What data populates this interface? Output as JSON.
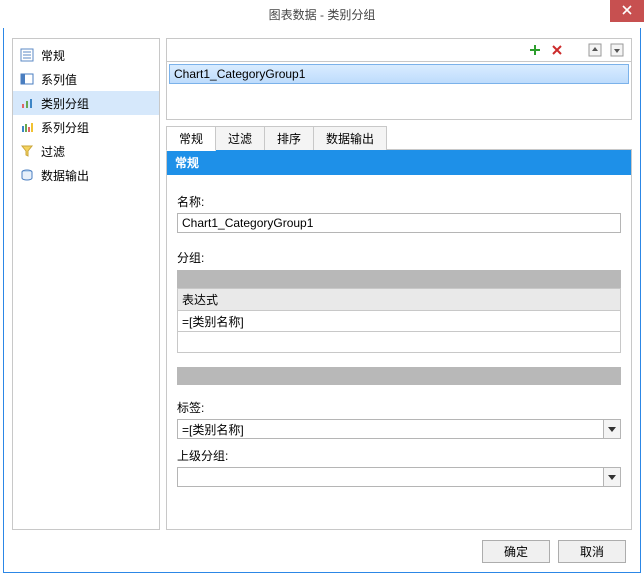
{
  "window": {
    "title": "图表数据 - 类别分组"
  },
  "sidebar": {
    "items": [
      {
        "label": "常规"
      },
      {
        "label": "系列值"
      },
      {
        "label": "类别分组"
      },
      {
        "label": "系列分组"
      },
      {
        "label": "过滤"
      },
      {
        "label": "数据输出"
      }
    ]
  },
  "groupList": {
    "items": [
      {
        "name": "Chart1_CategoryGroup1"
      }
    ]
  },
  "tabs": {
    "items": [
      {
        "label": "常规"
      },
      {
        "label": "过滤"
      },
      {
        "label": "排序"
      },
      {
        "label": "数据输出"
      }
    ]
  },
  "form": {
    "sectionTitle": "常规",
    "nameLabel": "名称:",
    "nameValue": "Chart1_CategoryGroup1",
    "groupLabel": "分组:",
    "exprHeader": "表达式",
    "exprValue": "=[类别名称]",
    "tagLabel": "标签:",
    "tagValue": "=[类别名称]",
    "parentLabel": "上级分组:",
    "parentValue": ""
  },
  "footer": {
    "ok": "确定",
    "cancel": "取消"
  }
}
